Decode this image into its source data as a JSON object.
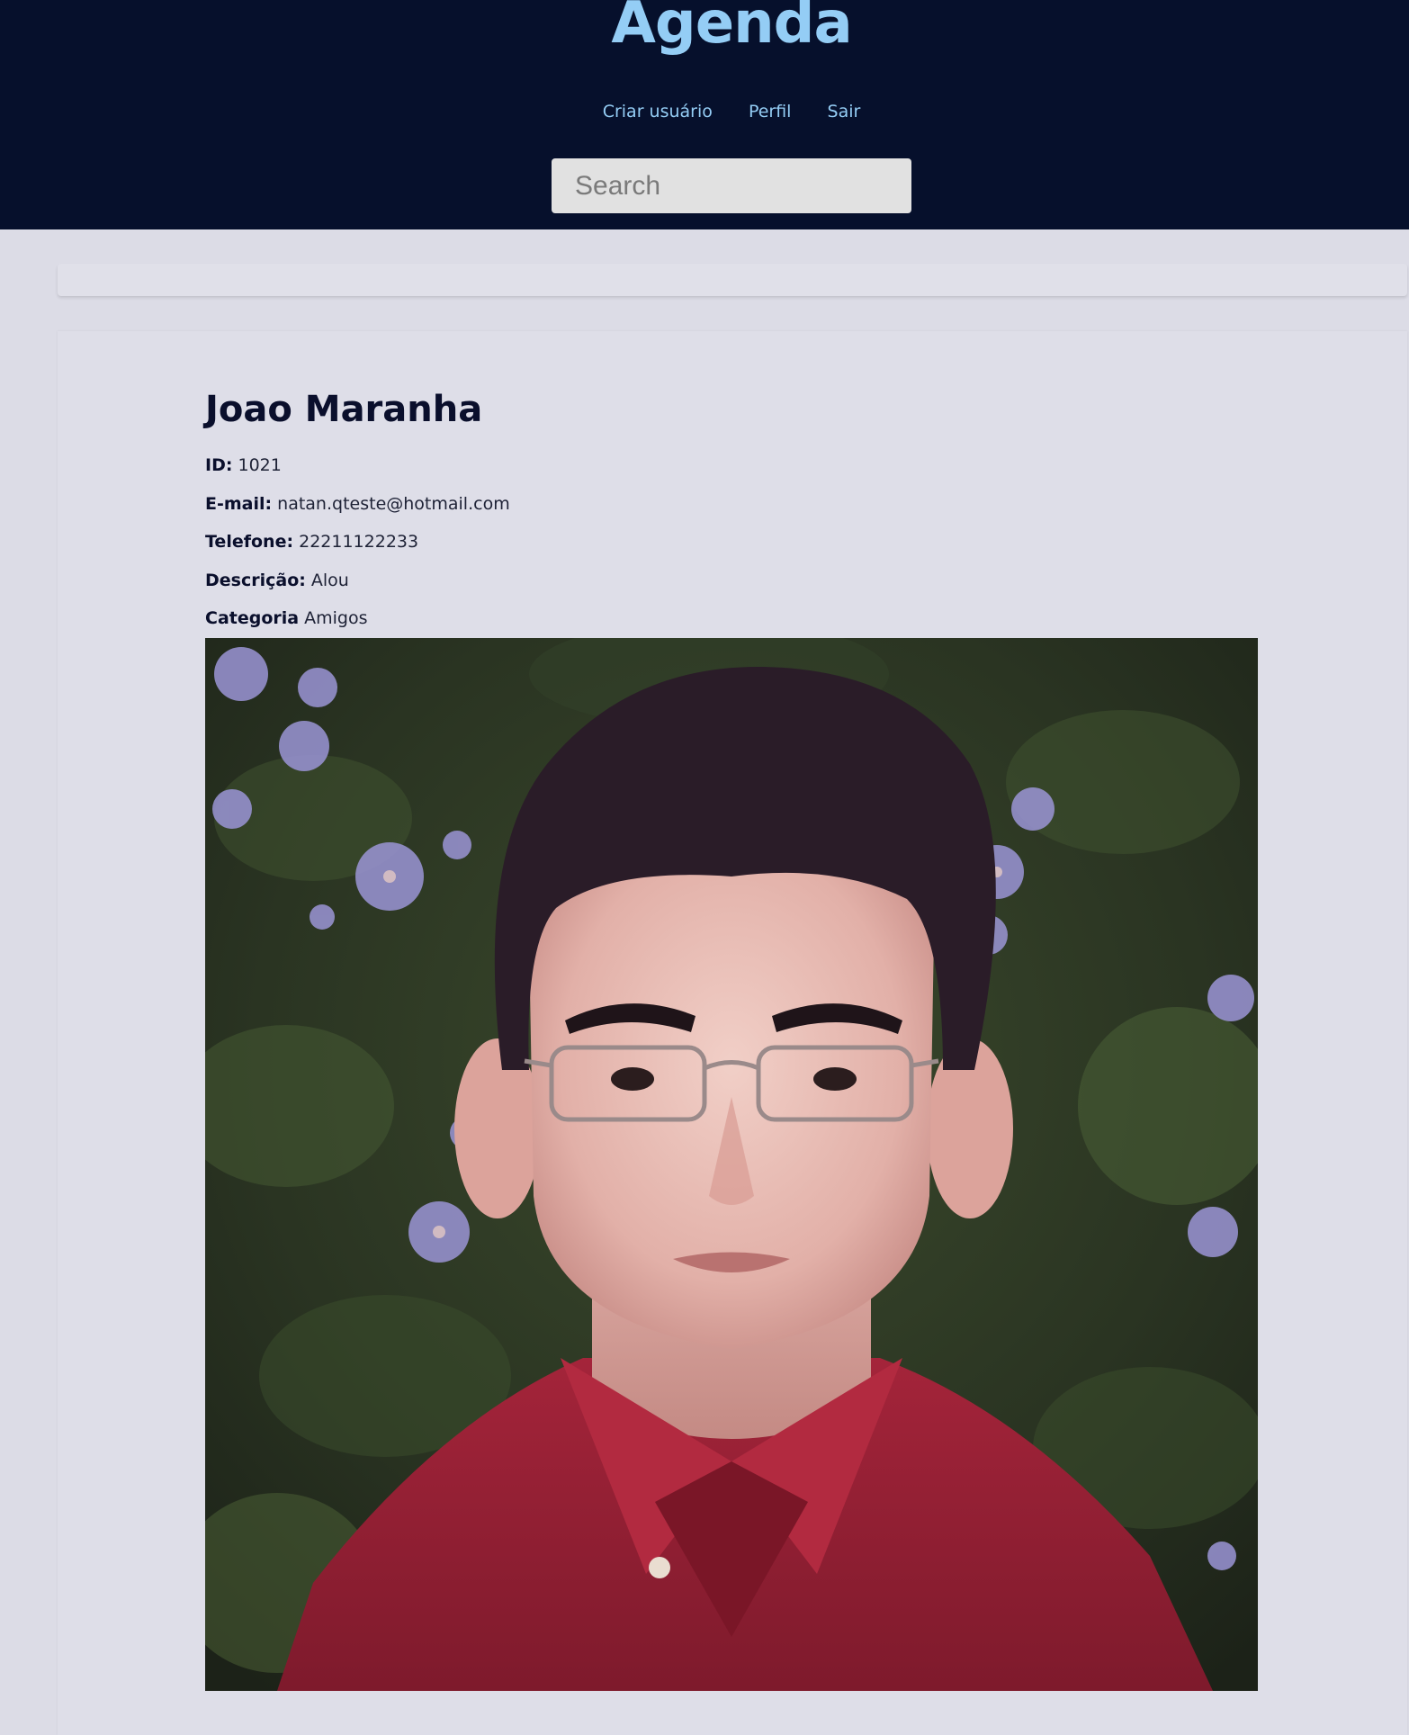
{
  "header": {
    "title": "Agenda",
    "nav": {
      "create_user": "Criar usuário",
      "profile": "Perfil",
      "logout": "Sair"
    },
    "search": {
      "placeholder": "Search",
      "value": ""
    }
  },
  "contact": {
    "name": "Joao Maranha",
    "fields": {
      "id": {
        "label": "ID:",
        "value": "1021"
      },
      "email": {
        "label": "E-mail:",
        "value": "natan.qteste@hotmail.com"
      },
      "phone": {
        "label": "Telefone:",
        "value": "22211122233"
      },
      "description": {
        "label": "Descrição:",
        "value": "Alou"
      },
      "category": {
        "label": "Categoria",
        "value": "Amigos"
      }
    },
    "photo_subject": "portrait-photo"
  },
  "colors": {
    "header_bg": "#06102c",
    "accent": "#94cdf5",
    "page_bg": "#dcdce6",
    "text": "#0a0f2c"
  }
}
